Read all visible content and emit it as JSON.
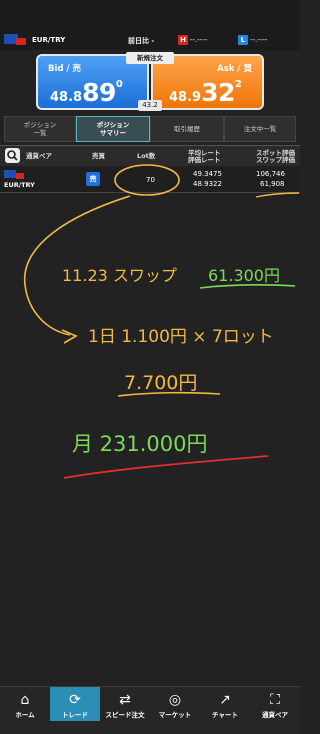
{
  "header": {
    "pair": "EUR/TRY",
    "prev_day_label": "前日比 -",
    "high_label": "H",
    "high_value": "--.----",
    "low_label": "L",
    "low_value": "--.----"
  },
  "prices": {
    "new_order_label": "新規注文",
    "bid_label": "Bid / 売",
    "bid_prefix": "48.8",
    "bid_big": "89",
    "bid_sup": "0",
    "ask_label": "Ask / 買",
    "ask_prefix": "48.9",
    "ask_big": "32",
    "ask_sup": "2",
    "spread": "43.2"
  },
  "tabs": [
    {
      "label_1": "ポジション",
      "label_2": "一覧"
    },
    {
      "label_1": "ポジション",
      "label_2": "サマリー"
    },
    {
      "label_1": "取引履歴",
      "label_2": ""
    },
    {
      "label_1": "注文中一覧",
      "label_2": ""
    }
  ],
  "table": {
    "headers": {
      "pair": "通貨ペア",
      "side": "売買",
      "lot": "Lot数",
      "avg_1": "平均レート",
      "avg_2": "評価レート",
      "swap_1": "スポット評価",
      "swap_2": "スワップ評価"
    },
    "row": {
      "pair": "EUR/TRY",
      "side": "売",
      "lot": "70",
      "avg_rate": "49.3475",
      "eval_rate": "48.9322",
      "spot_eval": "106,746",
      "swap_eval": "61,908"
    }
  },
  "notes": {
    "line1_date": "11.23  スワップ",
    "line1_amount": "61.300円",
    "line2": "1日  1.100円 × 7ロット",
    "line3": "7.700円",
    "line4": "月  231.000円"
  },
  "nav": [
    {
      "label": "ホーム",
      "icon": "home-icon"
    },
    {
      "label": "トレード",
      "icon": "trade-icon"
    },
    {
      "label": "スピード注文",
      "icon": "speed-order-icon"
    },
    {
      "label": "マーケット",
      "icon": "market-icon"
    },
    {
      "label": "チャート",
      "icon": "chart-icon"
    },
    {
      "label": "通貨ペア",
      "icon": "currency-pair-icon"
    }
  ],
  "colors": {
    "bid": "#1a6fd8",
    "ask": "#ef7608",
    "active_tab": "#5ab4c8",
    "note_orange": "#f4b942",
    "note_green": "#7ed957",
    "note_red": "#e0302b"
  }
}
